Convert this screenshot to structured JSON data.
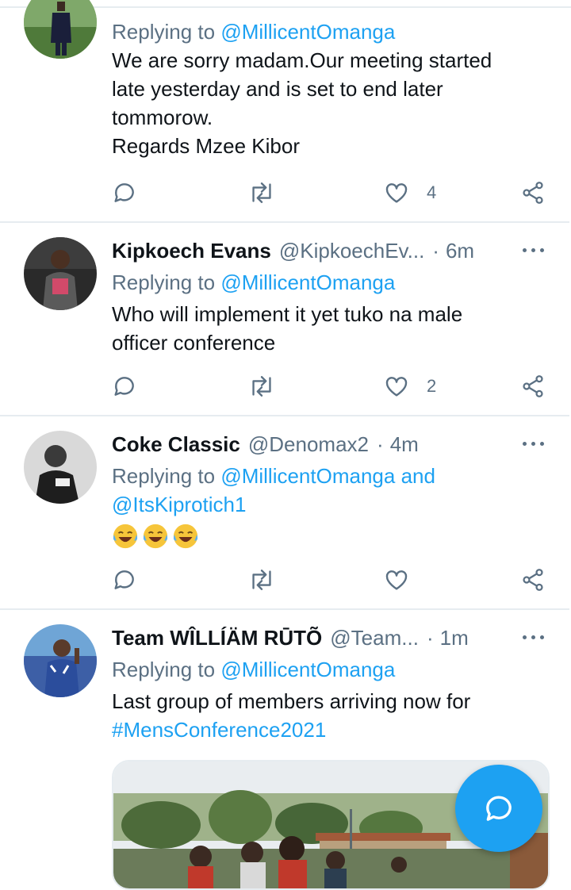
{
  "colors": {
    "accent": "#1da1f2",
    "secondary_text": "#5b7083",
    "divider": "#e6ecf0"
  },
  "tweets": [
    {
      "name": "",
      "handle": "",
      "time": "",
      "reply_prefix": "Replying to",
      "reply_to": "@MillicentOmanga",
      "reply_and": "",
      "reply_to2": "",
      "text_lines": [
        "We are sorry madam.Our meeting started",
        "late yesterday and is set to end later",
        "tommorow.",
        "Regards Mzee Kibor"
      ],
      "retweets": "",
      "likes": "4"
    },
    {
      "name": "Kipkoech Evans",
      "handle": "@KipkoechEv...",
      "time": "6m",
      "reply_prefix": "Replying to",
      "reply_to": "@MillicentOmanga",
      "text_lines": [
        "Who will implement it yet tuko na male",
        "officer conference"
      ],
      "likes": "2"
    },
    {
      "name": "Coke Classic",
      "handle": "@Denomax2",
      "time": "4m",
      "reply_prefix": "Replying to",
      "reply_to": "@MillicentOmanga",
      "reply_and": "and",
      "reply_to2": "@ItsKiprotich1",
      "emoji": [
        "face-with-tears-of-joy-icon",
        "face-with-tears-of-joy-icon",
        "face-with-tears-of-joy-icon"
      ],
      "likes": ""
    },
    {
      "name": "Team WÎLLÍÄM RŪTÕ",
      "handle": "@Team...",
      "time": "1m",
      "reply_prefix": "Replying to",
      "reply_to": "@MillicentOmanga",
      "text_lines": [
        "Last group of members arriving now for"
      ],
      "hashtag": "#MensConference2021"
    }
  ],
  "dot": "·"
}
